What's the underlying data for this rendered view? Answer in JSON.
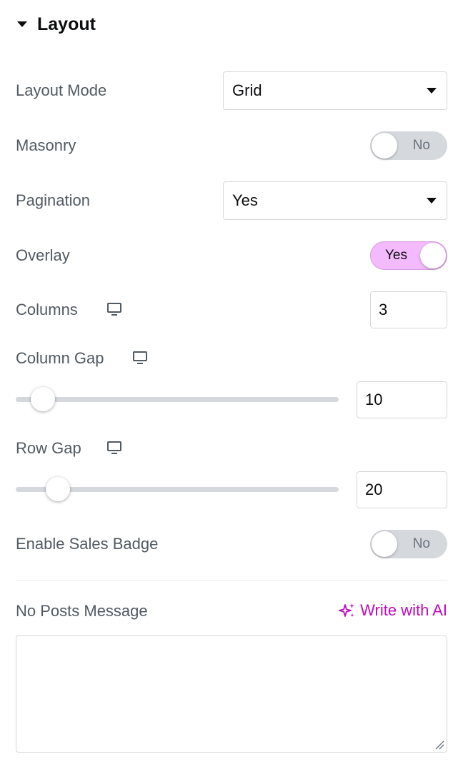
{
  "section": {
    "title": "Layout"
  },
  "layout_mode": {
    "label": "Layout Mode",
    "value": "Grid"
  },
  "masonry": {
    "label": "Masonry",
    "state_text": "No",
    "enabled": false
  },
  "pagination": {
    "label": "Pagination",
    "value": "Yes"
  },
  "overlay": {
    "label": "Overlay",
    "state_text": "Yes",
    "enabled": true
  },
  "columns": {
    "label": "Columns",
    "value": "3",
    "icon": "desktop-icon"
  },
  "column_gap": {
    "label": "Column Gap",
    "value": "10",
    "icon": "desktop-icon",
    "slider_fraction": 0.05
  },
  "row_gap": {
    "label": "Row Gap",
    "value": "20",
    "icon": "desktop-icon",
    "slider_fraction": 0.1
  },
  "sales_badge": {
    "label": "Enable Sales Badge",
    "state_text": "No",
    "enabled": false
  },
  "no_posts": {
    "label": "No Posts Message",
    "ai_link": "Write with AI",
    "value": ""
  },
  "colors": {
    "accent_pink": "#f3bafd",
    "ai_magenta": "#c00bb9",
    "toggle_off": "#d5d8dc"
  }
}
